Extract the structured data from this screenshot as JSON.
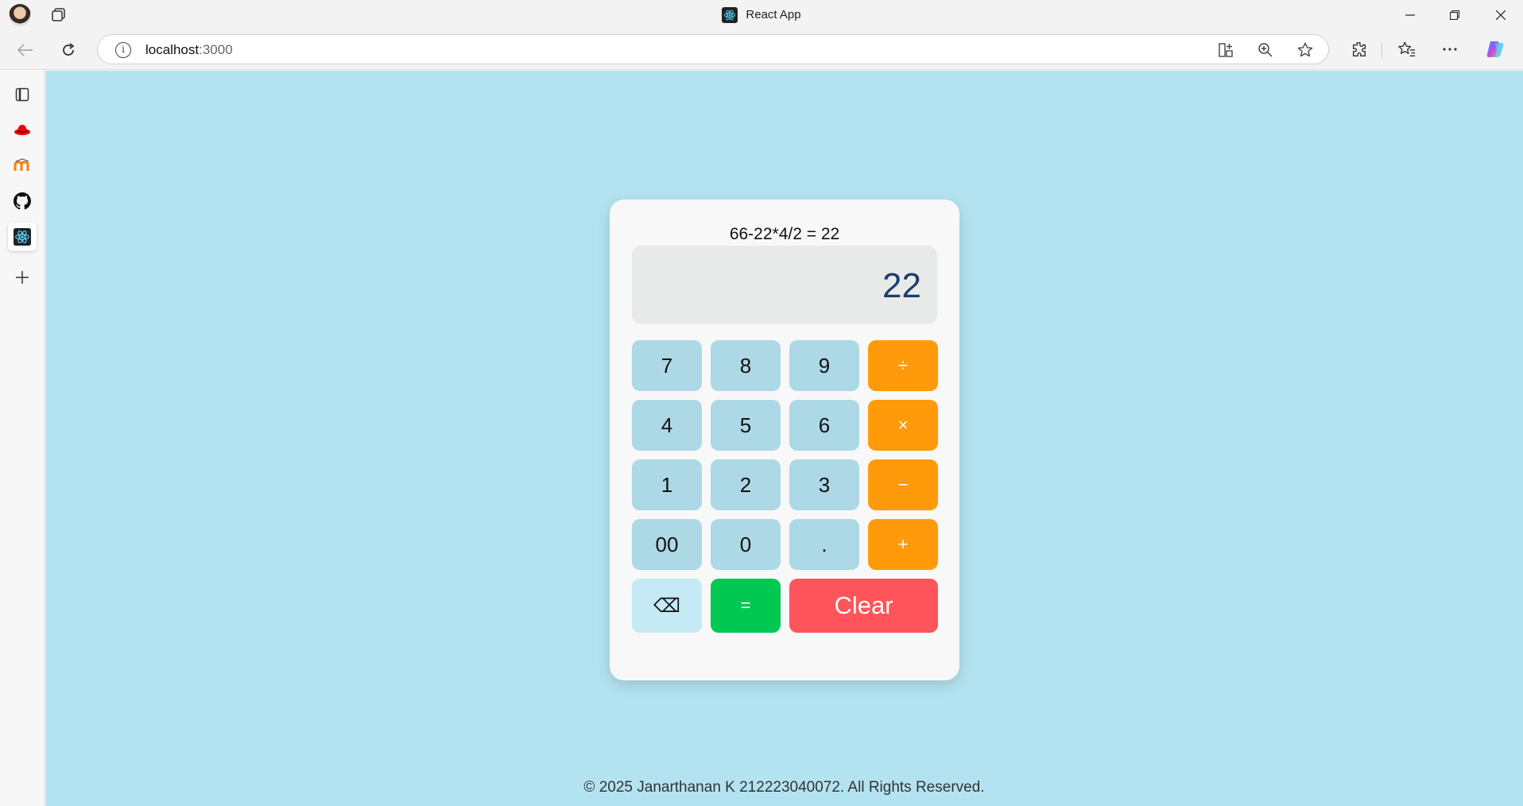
{
  "window": {
    "title": "React App",
    "controls": {
      "minimize": "—",
      "restore": "❐",
      "close": "✕"
    }
  },
  "address": {
    "host": "localhost",
    "port": ":3000"
  },
  "sidebar": {
    "items": [
      "tabs-panel",
      "redhat",
      "moodle",
      "github",
      "react-app",
      "add"
    ]
  },
  "calculator": {
    "history": "66-22*4/2 = 22",
    "display": "22",
    "keys": {
      "k7": "7",
      "k8": "8",
      "k9": "9",
      "div": "÷",
      "k4": "4",
      "k5": "5",
      "k6": "6",
      "mul": "×",
      "k1": "1",
      "k2": "2",
      "k3": "3",
      "sub": "−",
      "k00": "00",
      "k0": "0",
      "dot": ".",
      "add": "+",
      "back": "⌫",
      "eq": "=",
      "clear": "Clear"
    },
    "colors": {
      "number_key": "#add8e6",
      "operator_key": "#ff9a0a",
      "equals_key": "#00c851",
      "clear_key": "#ff5459",
      "page_bg": "#b3e3f1"
    }
  },
  "footer": {
    "text": "© 2025 Janarthanan K 212223040072. All Rights Reserved."
  }
}
